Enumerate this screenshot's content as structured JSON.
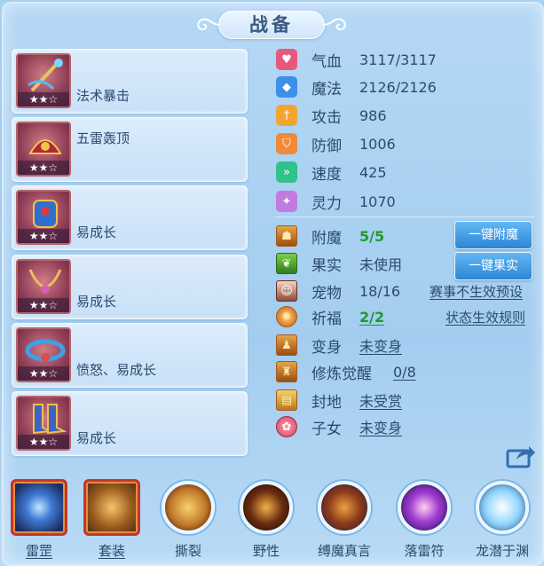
{
  "title": "战备",
  "equipment": [
    {
      "label": "法术暴击",
      "stars": "★★☆"
    },
    {
      "label": "五雷轰顶",
      "stars": "★★☆"
    },
    {
      "label": "易成长",
      "stars": "★★☆"
    },
    {
      "label": "易成长",
      "stars": "★★☆"
    },
    {
      "label": "愤怒、易成长",
      "stars": "★★☆"
    },
    {
      "label": "易成长",
      "stars": "★★☆"
    }
  ],
  "stats": [
    {
      "icon": "heart-icon",
      "label": "气血",
      "value": "3117/3117",
      "color": "#e8587a"
    },
    {
      "icon": "diamond-icon",
      "label": "魔法",
      "value": "2126/2126",
      "color": "#3d8fe8"
    },
    {
      "icon": "sword-icon",
      "label": "攻击",
      "value": "986",
      "color": "#f1a530"
    },
    {
      "icon": "shield-icon",
      "label": "防御",
      "value": "1006",
      "color": "#f08a3a"
    },
    {
      "icon": "speed-icon",
      "label": "速度",
      "value": "425",
      "color": "#2fc28a"
    },
    {
      "icon": "spirit-icon",
      "label": "灵力",
      "value": "1070",
      "color": "#c37ae0"
    }
  ],
  "status": [
    {
      "icon": "enchant-icon",
      "label": "附魔",
      "value": "5/5"
    },
    {
      "icon": "fruit-icon",
      "label": "果实",
      "value": "未使用"
    },
    {
      "icon": "pet-icon",
      "label": "宠物",
      "value": "18/16"
    },
    {
      "icon": "blessing-icon",
      "label": "祈福",
      "value": "2/2"
    },
    {
      "icon": "transform-icon",
      "label": "变身",
      "value": "未变身"
    },
    {
      "icon": "awaken-icon",
      "label": "修炼觉醒",
      "value": "0/8"
    },
    {
      "icon": "fief-icon",
      "label": "封地",
      "value": "未受赏"
    },
    {
      "icon": "child-icon",
      "label": "子女",
      "value": "未变身"
    }
  ],
  "buttons": {
    "enchant_all": "一键附魔",
    "fruit_all": "一键果实"
  },
  "links": {
    "event_invalid": "赛事不生效预设",
    "status_rules": "状态生效规则"
  },
  "skills": [
    {
      "label": "雷罡",
      "icon": "thunder-orb-icon"
    },
    {
      "label": "套装",
      "icon": "suit-icon"
    },
    {
      "label": "撕裂",
      "icon": "claw-icon"
    },
    {
      "label": "野性",
      "icon": "wild-icon"
    },
    {
      "label": "缚魔真言",
      "icon": "demon-bind-icon"
    },
    {
      "label": "落雷符",
      "icon": "thunder-talisman-icon"
    },
    {
      "label": "龙潜于渊",
      "icon": "dragon-icon"
    }
  ]
}
